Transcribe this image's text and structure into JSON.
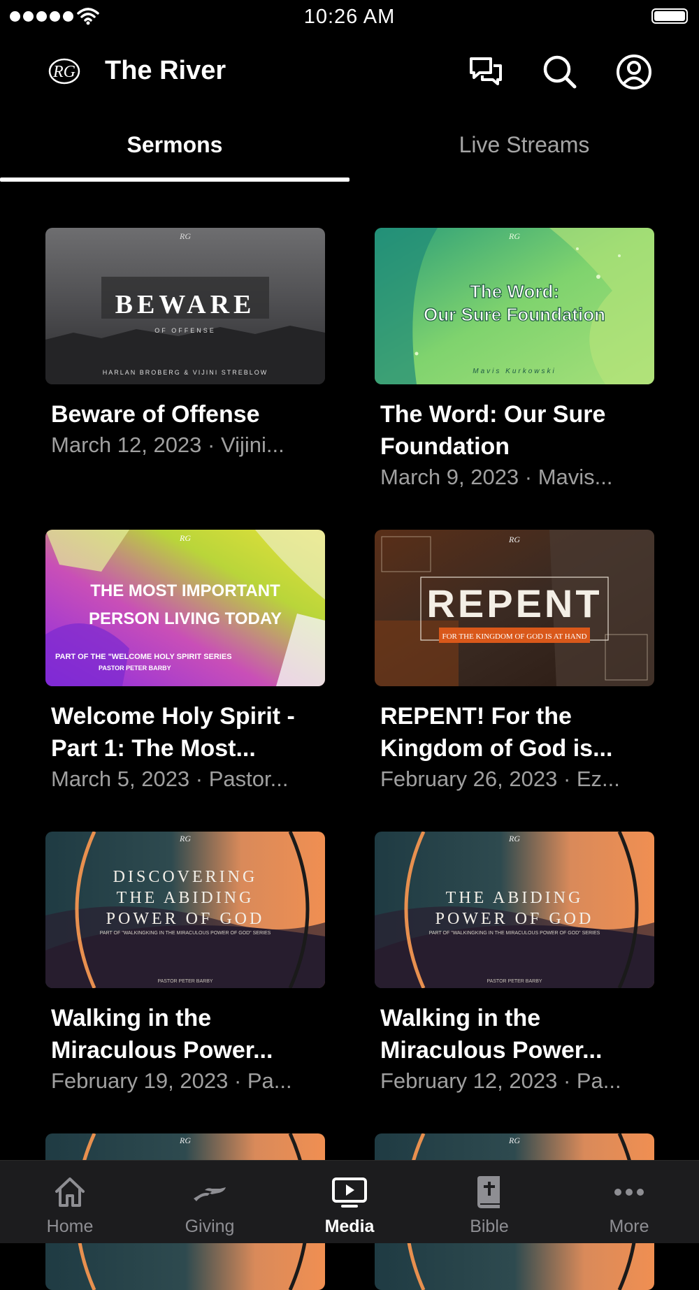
{
  "status_bar": {
    "time": "10:26 AM"
  },
  "header": {
    "logo_text": "RG",
    "title": "The River",
    "icons": [
      "chat-icon",
      "search-icon",
      "profile-icon"
    ]
  },
  "tabs": [
    {
      "label": "Sermons",
      "active": true
    },
    {
      "label": "Live Streams",
      "active": false
    }
  ],
  "sermons": [
    {
      "title": "Beware of Offense",
      "meta": "March 12, 2023 · Vijini...",
      "thumb": {
        "logo": "RG",
        "headline": "BEWARE",
        "sub": "OF OFFENSE",
        "credit": "HARLAN BROBERG & VIJINI STREBLOW"
      }
    },
    {
      "title": "The Word: Our Sure Foundation",
      "meta": "March 9, 2023 · Mavis...",
      "thumb": {
        "logo": "RG",
        "line1": "The Word:",
        "line2": "Our Sure Foundation",
        "credit": "Mavis Kurkowski"
      }
    },
    {
      "title": "Welcome Holy Spirit - Part 1: The Most...",
      "meta": "March 5, 2023 · Pastor...",
      "thumb": {
        "logo": "RG",
        "line1": "THE MOST IMPORTANT",
        "line2": "PERSON LIVING TODAY",
        "series": "PART OF THE \"WELCOME HOLY SPIRIT SERIES",
        "credit": "PASTOR PETER BARBY"
      }
    },
    {
      "title": "REPENT! For the Kingdom of God is...",
      "meta": "February 26, 2023 · Ez...",
      "thumb": {
        "logo": "RG",
        "headline": "REPENT",
        "banner": "FOR THE KINGDOM OF GOD IS AT HAND"
      }
    },
    {
      "title": "Walking in the Miraculous Power...",
      "meta": "February 19, 2023 · Pa...",
      "thumb": {
        "logo": "RG",
        "line1": "DISCOVERING",
        "line2": "THE ABIDING",
        "line3": "POWER OF GOD",
        "series": "PART OF \"WALKINGKING IN THE MIRACULOUS POWER OF GOD\" SERIES",
        "credit": "PASTOR PETER BARBY"
      }
    },
    {
      "title": "Walking in the Miraculous Power...",
      "meta": "February 12, 2023 · Pa...",
      "thumb": {
        "logo": "RG",
        "line1": "THE ABIDING",
        "line2": "POWER OF GOD",
        "series": "PART OF \"WALKINGKING IN THE MIRACULOUS POWER OF GOD\" SERIES",
        "credit": "PASTOR PETER BARBY"
      }
    }
  ],
  "partial_thumbs": [
    {
      "logo": "RG"
    },
    {
      "logo": "RG"
    }
  ],
  "bottom_nav": [
    {
      "label": "Home",
      "icon": "home-icon",
      "active": false
    },
    {
      "label": "Giving",
      "icon": "giving-icon",
      "active": false
    },
    {
      "label": "Media",
      "icon": "media-icon",
      "active": true
    },
    {
      "label": "Bible",
      "icon": "bible-icon",
      "active": false
    },
    {
      "label": "More",
      "icon": "more-icon",
      "active": false
    }
  ],
  "colors": {
    "background": "#000000",
    "nav_background": "#1c1c1e",
    "inactive": "#8e8e93",
    "repent_banner": "#d9581a"
  }
}
